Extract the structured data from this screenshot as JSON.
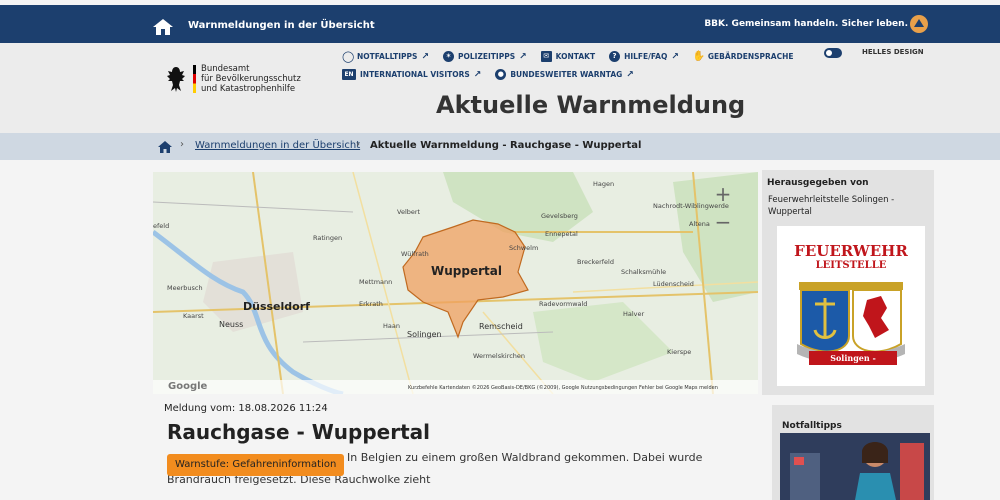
{
  "topbar": {
    "title": "Warnmeldungen in der Übersicht",
    "slogan": "BBK. Gemeinsam handeln. Sicher leben."
  },
  "header": {
    "org_name_lines": [
      "Bundesamt",
      "für Bevölkerungsschutz",
      "und Katastrophenhilfe"
    ],
    "nav_row1": [
      {
        "label": "NOTFALLTIPPS",
        "icon": "lightbulb-icon"
      },
      {
        "label": "POLIZEITIPPS",
        "icon": "police-badge-icon"
      },
      {
        "label": "KONTAKT",
        "icon": "contact-card-icon"
      },
      {
        "label": "HILFE/FAQ",
        "icon": "help-icon"
      },
      {
        "label": "GEBÄRDENSPRACHE",
        "icon": "sign-language-icon"
      }
    ],
    "nav_row2": [
      {
        "label": "INTERNATIONAL VISITORS",
        "icon": "en-language-icon"
      },
      {
        "label": "BUNDESWEITER WARNTAG",
        "icon": "warntag-icon"
      }
    ],
    "design_toggle_label": "HELLES DESIGN",
    "page_title": "Aktuelle Warnmeldung"
  },
  "breadcrumb": {
    "link": "Warnmeldungen in der Übersicht",
    "current": "Aktuelle Warnmeldung - Rauchgase - Wuppertal"
  },
  "map": {
    "cities": {
      "wuppertal": "Wuppertal",
      "duesseldorf": "Düsseldorf",
      "solingen": "Solingen",
      "remscheid": "Remscheid",
      "velbert": "Velbert",
      "hagen": "Hagen",
      "gevelsberg": "Gevelsberg",
      "schwelm": "Schwelm",
      "ennepetal": "Ennepetal",
      "mettmann": "Mettmann",
      "ratingen": "Ratingen",
      "neuss": "Neuss",
      "meerbusch": "Meerbusch",
      "haan": "Haan",
      "erkrath": "Erkrath",
      "breckerfeld": "Breckerfeld",
      "radevormwald": "Radevormwald",
      "luedenscheid": "Lüdenscheid",
      "altena": "Altena",
      "halver": "Halver",
      "wermelskirchen": "Wermelskirchen",
      "wuelfrath": "Wülfrath",
      "schalksmuehle": "Schalksmühle",
      "nachrodt": "Nachrodt-Wiblingwerde",
      "kaarst": "Kaarst",
      "efeld": "efeld",
      "kierspe": "Kierspe"
    },
    "zoom_in": "+",
    "zoom_out": "−",
    "google": "Google",
    "credits": "Kurzbefehle    Kartendaten ©2026 GeoBasis-DE/BKG (©2009), Google    Nutzungsbedingungen    Fehler bei Google Maps melden",
    "area_color": "#f0a060"
  },
  "alert": {
    "date": "Meldung vom: 18.08.2026 11:24",
    "title": "Rauchgase - Wuppertal",
    "level": "Warnstufe: Gefahreninformation",
    "level_color": "#f28c1e",
    "body": "In Belgien zu einem großen Waldbrand gekommen. Dabei wurde Brandrauch freigesetzt. Diese Rauchwolke zieht"
  },
  "sidebar": {
    "issuer_heading": "Herausgegeben von",
    "issuer": "Feuerwehrleitstelle Solingen - Wuppertal",
    "crest_line1": "FEUERWEHR",
    "crest_line2": "LEITSTELLE",
    "crest_banner": "Solingen - Wuppertal",
    "tips_heading": "Notfalltipps"
  }
}
